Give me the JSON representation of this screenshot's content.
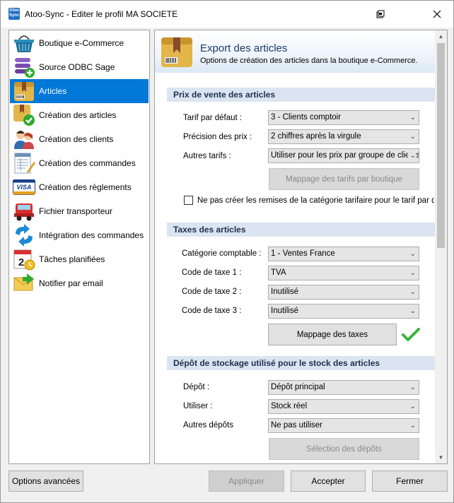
{
  "window": {
    "title": "Atoo-Sync - Editer le profil MA SOCIETE",
    "app_icon_text": "Atoo Sync"
  },
  "sidebar": {
    "items": [
      {
        "label": "Boutique e-Commerce",
        "icon": "basket-icon"
      },
      {
        "label": "Source ODBC Sage",
        "icon": "database-add-icon"
      },
      {
        "label": "Articles",
        "icon": "box-icon",
        "selected": true
      },
      {
        "label": "Création des articles",
        "icon": "box-check-icon"
      },
      {
        "label": "Création des clients",
        "icon": "users-icon"
      },
      {
        "label": "Création des commandes",
        "icon": "order-form-icon"
      },
      {
        "label": "Création des règlements",
        "icon": "visa-card-icon"
      },
      {
        "label": "Fichier transporteur",
        "icon": "truck-icon"
      },
      {
        "label": "Intégration des commandes",
        "icon": "sync-arrows-icon"
      },
      {
        "label": "Tâches planifiées",
        "icon": "calendar-clock-icon"
      },
      {
        "label": "Notifier par email",
        "icon": "email-icon"
      }
    ]
  },
  "header": {
    "title": "Export des articles",
    "subtitle": "Options de création des articles dans la boutique e-Commerce."
  },
  "prix": {
    "section_title": "Prix de vente des articles",
    "tarif_label": "Tarif par défaut :",
    "tarif_value": "3 - Clients comptoir",
    "precision_label": "Précision des prix :",
    "precision_value": "2 chiffres après la virgule",
    "autres_label": "Autres tarifs :",
    "autres_value": "Utiliser pour les prix par groupe de clients",
    "mapping_button": "Mappage des tarifs par boutique",
    "checkbox_label": "Ne pas créer les remises de la catégorie tarifaire pour le tarif par défaut",
    "checkbox_checked": false
  },
  "taxes": {
    "section_title": "Taxes des articles",
    "categorie_label": "Catégorie comptable :",
    "categorie_value": "1 - Ventes France",
    "code1_label": "Code de taxe 1 :",
    "code1_value": "TVA",
    "code2_label": "Code de taxe 2 :",
    "code2_value": "Inutilisé",
    "code3_label": "Code de taxe 3 :",
    "code3_value": "Inutilisé",
    "mapping_button": "Mappage des taxes",
    "status_color": "#3cb43c"
  },
  "depot": {
    "section_title": "Dépôt de stockage utilisé pour le stock des articles",
    "depot_label": "Dépôt :",
    "depot_value": "Dépôt principal",
    "utiliser_label": "Utiliser :",
    "utiliser_value": "Stock réel",
    "autres_label": "Autres dépôts",
    "autres_value": "Ne pas utiliser",
    "selection_button": "Sélection des dépôts"
  },
  "footer": {
    "options_button": "Options avancées",
    "apply_button": "Appliquer",
    "accept_button": "Accepter",
    "close_button": "Fermer"
  },
  "colors": {
    "selected": "#0078d7",
    "section_bg": "#dbe5f1"
  }
}
